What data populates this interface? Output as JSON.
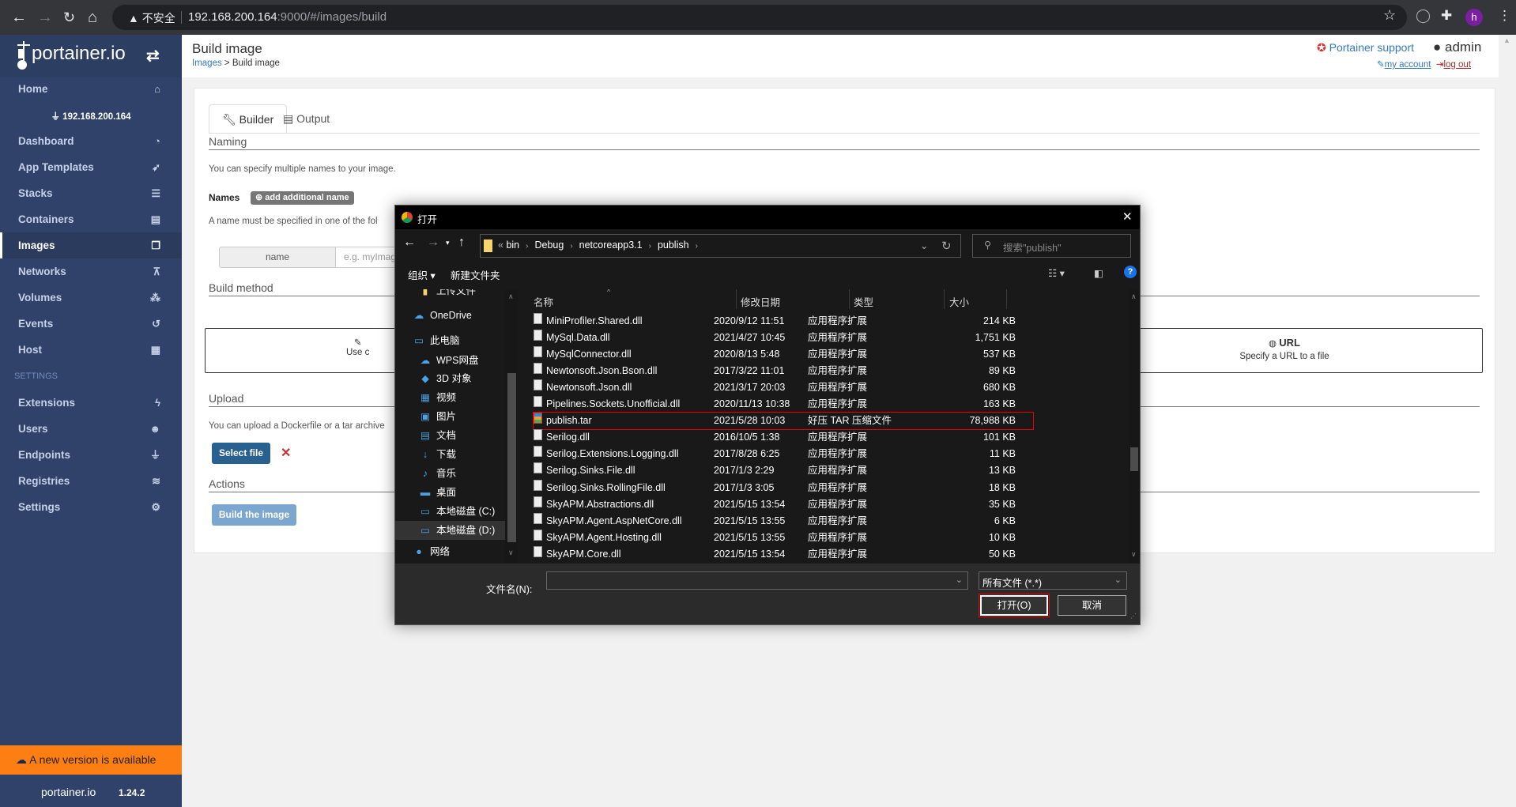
{
  "browser": {
    "security": "不安全",
    "url_host": "192.168.200.164",
    "url_rest": ":9000/#/images/build",
    "avatar": "h"
  },
  "sidebar": {
    "logo": "portainer.io",
    "endpoint": "192.168.200.164",
    "section_settings": "SETTINGS",
    "items": [
      {
        "label": "Home",
        "icon": "home-icon",
        "glyph": "⌂"
      },
      {
        "label": "Dashboard",
        "icon": "tachometer-icon",
        "glyph": "◔"
      },
      {
        "label": "App Templates",
        "icon": "rocket-icon",
        "glyph": "➶"
      },
      {
        "label": "Stacks",
        "icon": "th-list-icon",
        "glyph": "☰"
      },
      {
        "label": "Containers",
        "icon": "server-icon",
        "glyph": "▤"
      },
      {
        "label": "Images",
        "icon": "clone-icon",
        "glyph": "❐"
      },
      {
        "label": "Networks",
        "icon": "sitemap-icon",
        "glyph": "⊼"
      },
      {
        "label": "Volumes",
        "icon": "cubes-icon",
        "glyph": "⁂"
      },
      {
        "label": "Events",
        "icon": "history-icon",
        "glyph": "↺"
      },
      {
        "label": "Host",
        "icon": "th-icon",
        "glyph": "▦"
      }
    ],
    "settings_items": [
      {
        "label": "Extensions",
        "icon": "bolt-icon",
        "glyph": "ϟ"
      },
      {
        "label": "Users",
        "icon": "users-icon",
        "glyph": "☻"
      },
      {
        "label": "Endpoints",
        "icon": "plug-icon",
        "glyph": "⏚"
      },
      {
        "label": "Registries",
        "icon": "database-icon",
        "glyph": "≋"
      },
      {
        "label": "Settings",
        "icon": "cogs-icon",
        "glyph": "⚙"
      }
    ],
    "update_banner": "A new version is available",
    "footer_logo": "portainer.io",
    "version": "1.24.2"
  },
  "header": {
    "title": "Build image",
    "breadcrumb_parent": "Images",
    "breadcrumb_current": "Build image",
    "support": "Portainer support",
    "user": "admin",
    "my_account": "my account",
    "log_out": "log out"
  },
  "builder": {
    "tabs": [
      "Builder",
      "Output"
    ],
    "naming": "Naming",
    "naming_help": "You can specify multiple names to your image.",
    "names_label": "Names",
    "add_name": "add additional name",
    "name_required": "A name must be specified in one of the fol",
    "name_addon": "name",
    "name_placeholder": "e.g. myImag",
    "build_method": "Build method",
    "method_left_sub": "Use c",
    "method_url_title": "URL",
    "method_url_sub": "Specify a URL to a file",
    "upload": "Upload",
    "upload_help": "You can upload a Dockerfile or a tar archive",
    "select_file": "Select file",
    "actions": "Actions",
    "build_button": "Build the image"
  },
  "dialog": {
    "title": "打开",
    "path": [
      "bin",
      "Debug",
      "netcoreapp3.1",
      "publish"
    ],
    "search_placeholder": "搜索\"publish\"",
    "organize": "组织 ▾",
    "new_folder": "新建文件夹",
    "nav": [
      {
        "label": "上传文件",
        "glyph": "▮"
      },
      {
        "label": "OneDrive",
        "glyph": "☁"
      },
      {
        "label": "此电脑",
        "glyph": "▭"
      },
      {
        "label": "WPS网盘",
        "glyph": "☁"
      },
      {
        "label": "3D 对象",
        "glyph": "◆"
      },
      {
        "label": "视频",
        "glyph": "▦"
      },
      {
        "label": "图片",
        "glyph": "▣"
      },
      {
        "label": "文档",
        "glyph": "▤"
      },
      {
        "label": "下载",
        "glyph": "↓"
      },
      {
        "label": "音乐",
        "glyph": "♪"
      },
      {
        "label": "桌面",
        "glyph": "▬"
      },
      {
        "label": "本地磁盘 (C:)",
        "glyph": "▭"
      },
      {
        "label": "本地磁盘 (D:)",
        "glyph": "▭",
        "selected": true
      },
      {
        "label": "网络",
        "glyph": "●"
      }
    ],
    "columns": [
      "名称",
      "修改日期",
      "类型",
      "大小"
    ],
    "files": [
      [
        "MiniProfiler.Shared.dll",
        "2020/9/12 11:51",
        "应用程序扩展",
        "214 KB"
      ],
      [
        "MySql.Data.dll",
        "2021/4/27 10:45",
        "应用程序扩展",
        "1,751 KB"
      ],
      [
        "MySqlConnector.dll",
        "2020/8/13 5:48",
        "应用程序扩展",
        "537 KB"
      ],
      [
        "Newtonsoft.Json.Bson.dll",
        "2017/3/22 11:01",
        "应用程序扩展",
        "89 KB"
      ],
      [
        "Newtonsoft.Json.dll",
        "2021/3/17 20:03",
        "应用程序扩展",
        "680 KB"
      ],
      [
        "Pipelines.Sockets.Unofficial.dll",
        "2020/11/13 10:38",
        "应用程序扩展",
        "163 KB"
      ],
      [
        "publish.tar",
        "2021/5/28 10:03",
        "好压 TAR 压缩文件",
        "78,988 KB"
      ],
      [
        "Serilog.dll",
        "2016/10/5 1:38",
        "应用程序扩展",
        "101 KB"
      ],
      [
        "Serilog.Extensions.Logging.dll",
        "2017/8/28 6:25",
        "应用程序扩展",
        "11 KB"
      ],
      [
        "Serilog.Sinks.File.dll",
        "2017/1/3 2:29",
        "应用程序扩展",
        "13 KB"
      ],
      [
        "Serilog.Sinks.RollingFile.dll",
        "2017/1/3 3:05",
        "应用程序扩展",
        "18 KB"
      ],
      [
        "SkyAPM.Abstractions.dll",
        "2021/5/15 13:54",
        "应用程序扩展",
        "35 KB"
      ],
      [
        "SkyAPM.Agent.AspNetCore.dll",
        "2021/5/15 13:55",
        "应用程序扩展",
        "6 KB"
      ],
      [
        "SkyAPM.Agent.Hosting.dll",
        "2021/5/15 13:55",
        "应用程序扩展",
        "10 KB"
      ],
      [
        "SkyAPM.Core.dll",
        "2021/5/15 13:54",
        "应用程序扩展",
        "50 KB"
      ]
    ],
    "highlighted_file": "publish.tar",
    "filename_label": "文件名(N):",
    "filename_value": "",
    "filter": "所有文件 (*.*)",
    "open": "打开(O)",
    "cancel": "取消"
  },
  "colors": {
    "sidebar": "#30426a",
    "update_banner": "#fd7f13",
    "primary_button": "#286090",
    "highlight_outline": "#ee0000"
  }
}
